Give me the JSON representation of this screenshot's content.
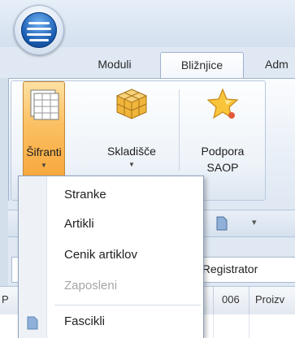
{
  "tabs": [
    {
      "label": "Moduli"
    },
    {
      "label": "Bližnjice"
    },
    {
      "label": "Adm"
    }
  ],
  "ribbon": {
    "buttons": [
      {
        "label": "Šifranti",
        "icon": "grid-table-icon"
      },
      {
        "label": "Skladišče",
        "icon": "warehouse-boxes-icon"
      },
      {
        "label_line1": "Podpora",
        "label_line2": "SAOP",
        "icon": "star-icon"
      }
    ]
  },
  "quick_access": {
    "dropdown_glyph": "▾",
    "icon": "document-icon"
  },
  "document_bar": {
    "text": "eRegistrator"
  },
  "column_header": {
    "cells": [
      {
        "text": "P"
      },
      {
        "text": "006"
      },
      {
        "text": "Proizv"
      }
    ]
  },
  "menu": {
    "items": [
      {
        "label": "Stranke",
        "enabled": true
      },
      {
        "label": "Artikli",
        "enabled": true
      },
      {
        "label": "Cenik artiklov",
        "enabled": true
      },
      {
        "label": "Zaposleni",
        "enabled": false
      },
      {
        "label": "Fascikli",
        "enabled": true,
        "icon": "folder-icon"
      }
    ]
  },
  "colors": {
    "accent_pressed": "#f8a83d",
    "ribbon_border": "#9db2cf",
    "disabled_text": "#a6a6a6",
    "folder_icon": "#5f86b8"
  }
}
